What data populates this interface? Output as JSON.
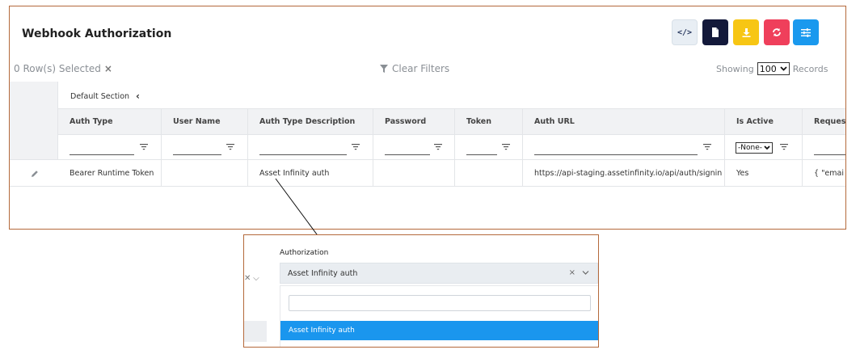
{
  "page": {
    "title": "Webhook Authorization"
  },
  "toolbar": {
    "code_label": "</>",
    "colors": {
      "code": "#e8eef4",
      "doc": "#13193a",
      "download": "#f7c614",
      "refresh": "#ef3f5b",
      "settings": "#1a99ee"
    },
    "icons": [
      "code-icon",
      "document-icon",
      "download-icon",
      "refresh-icon",
      "sliders-icon"
    ]
  },
  "selection": {
    "text": "0 Row(s) Selected",
    "clear_symbol": "×"
  },
  "filters": {
    "clear_label": "Clear Filters"
  },
  "paging": {
    "showing_label": "Showing",
    "records_label": "Records",
    "page_size": "100"
  },
  "grid": {
    "section_label": "Default Section",
    "section_chevron": "‹",
    "columns": [
      "Auth Type",
      "User Name",
      "Auth Type Description",
      "Password",
      "Token",
      "Auth URL",
      "Is Active",
      "Reques"
    ],
    "is_active_filter": "-None-",
    "rows": [
      {
        "auth_type": "Bearer Runtime Token",
        "user_name": "",
        "auth_type_description": "Asset Infinity auth",
        "password": "",
        "token": "",
        "auth_url": "https://api-staging.assetinfinity.io/api/auth/signin",
        "is_active": "Yes",
        "request": "{ \"emai"
      }
    ]
  },
  "zoom": {
    "label": "Authorization",
    "selected_value": "Asset Infinity auth",
    "clear_symbol": "×",
    "search_value": "",
    "options": [
      "Asset Infinity auth"
    ],
    "highlight_color": "#1a96ee"
  }
}
